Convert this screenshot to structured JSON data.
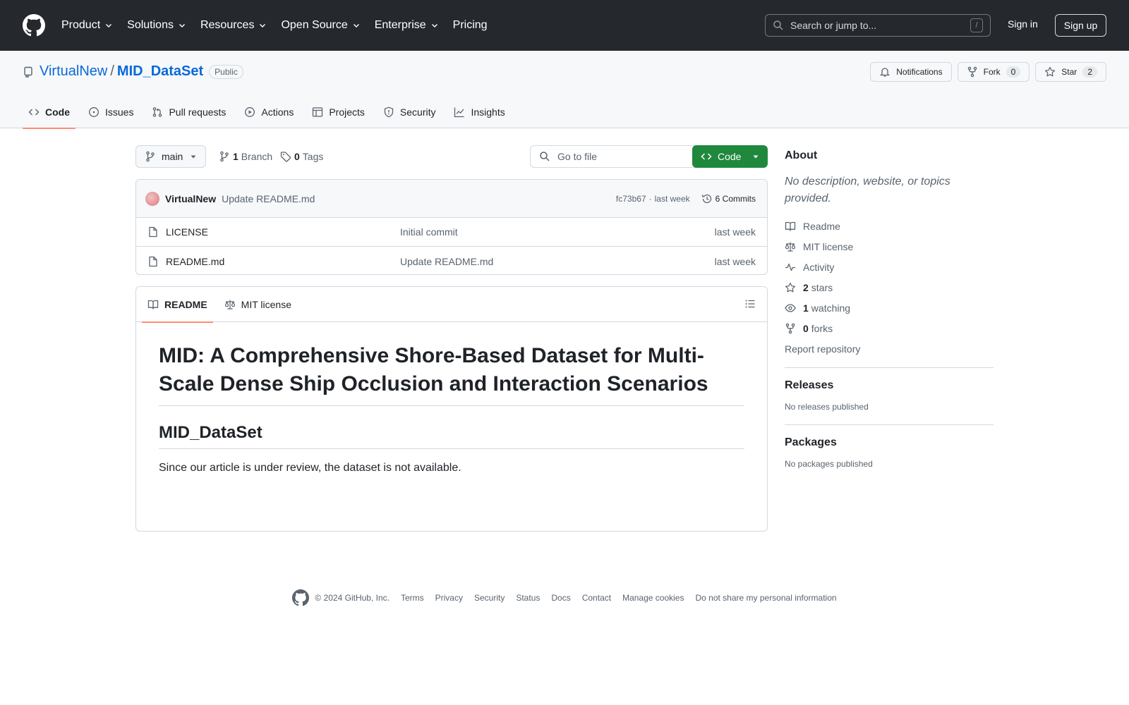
{
  "header": {
    "nav": [
      "Product",
      "Solutions",
      "Resources",
      "Open Source",
      "Enterprise",
      "Pricing"
    ],
    "search_placeholder": "Search or jump to...",
    "search_shortcut": "/",
    "sign_in": "Sign in",
    "sign_up": "Sign up"
  },
  "repo": {
    "owner": "VirtualNew",
    "separator": "/",
    "name": "MID_DataSet",
    "visibility": "Public",
    "notifications_label": "Notifications",
    "fork_label": "Fork",
    "fork_count": "0",
    "star_label": "Star",
    "star_count": "2",
    "tabs": [
      "Code",
      "Issues",
      "Pull requests",
      "Actions",
      "Projects",
      "Security",
      "Insights"
    ]
  },
  "browser": {
    "branch": "main",
    "branch_count": "1",
    "branch_label": "Branch",
    "tag_count": "0",
    "tag_label": "Tags",
    "goto_placeholder": "Go to file",
    "code_button": "Code",
    "commit": {
      "author": "VirtualNew",
      "message": "Update README.md",
      "hash": "fc73b67",
      "dot": "·",
      "time": "last week",
      "commits_label": "6 Commits"
    },
    "files": [
      {
        "name": "LICENSE",
        "message": "Initial commit",
        "time": "last week"
      },
      {
        "name": "README.md",
        "message": "Update README.md",
        "time": "last week"
      }
    ]
  },
  "readme": {
    "tabs": [
      "README",
      "MIT license"
    ],
    "h1": "MID: A Comprehensive Shore-Based Dataset for Multi-Scale Dense Ship Occlusion and Interaction Scenarios",
    "h2": "MID_DataSet",
    "paragraph": "Since our article is under review, the dataset is not available."
  },
  "sidebar": {
    "about_title": "About",
    "about_desc": "No description, website, or topics provided.",
    "items": [
      {
        "label": "Readme"
      },
      {
        "label": "MIT license"
      },
      {
        "label": "Activity"
      },
      {
        "count": "2",
        "label": "stars"
      },
      {
        "count": "1",
        "label": "watching"
      },
      {
        "count": "0",
        "label": "forks"
      }
    ],
    "report": "Report repository",
    "releases_title": "Releases",
    "releases_desc": "No releases published",
    "packages_title": "Packages",
    "packages_desc": "No packages published"
  },
  "footer": {
    "copyright": "© 2024 GitHub, Inc.",
    "links": [
      "Terms",
      "Privacy",
      "Security",
      "Status",
      "Docs",
      "Contact",
      "Manage cookies",
      "Do not share my personal information"
    ]
  },
  "colors": {
    "header_bg": "#25292e",
    "link": "#0969da",
    "primary_button": "#1f883d",
    "tab_underline": "#fd8c73"
  }
}
